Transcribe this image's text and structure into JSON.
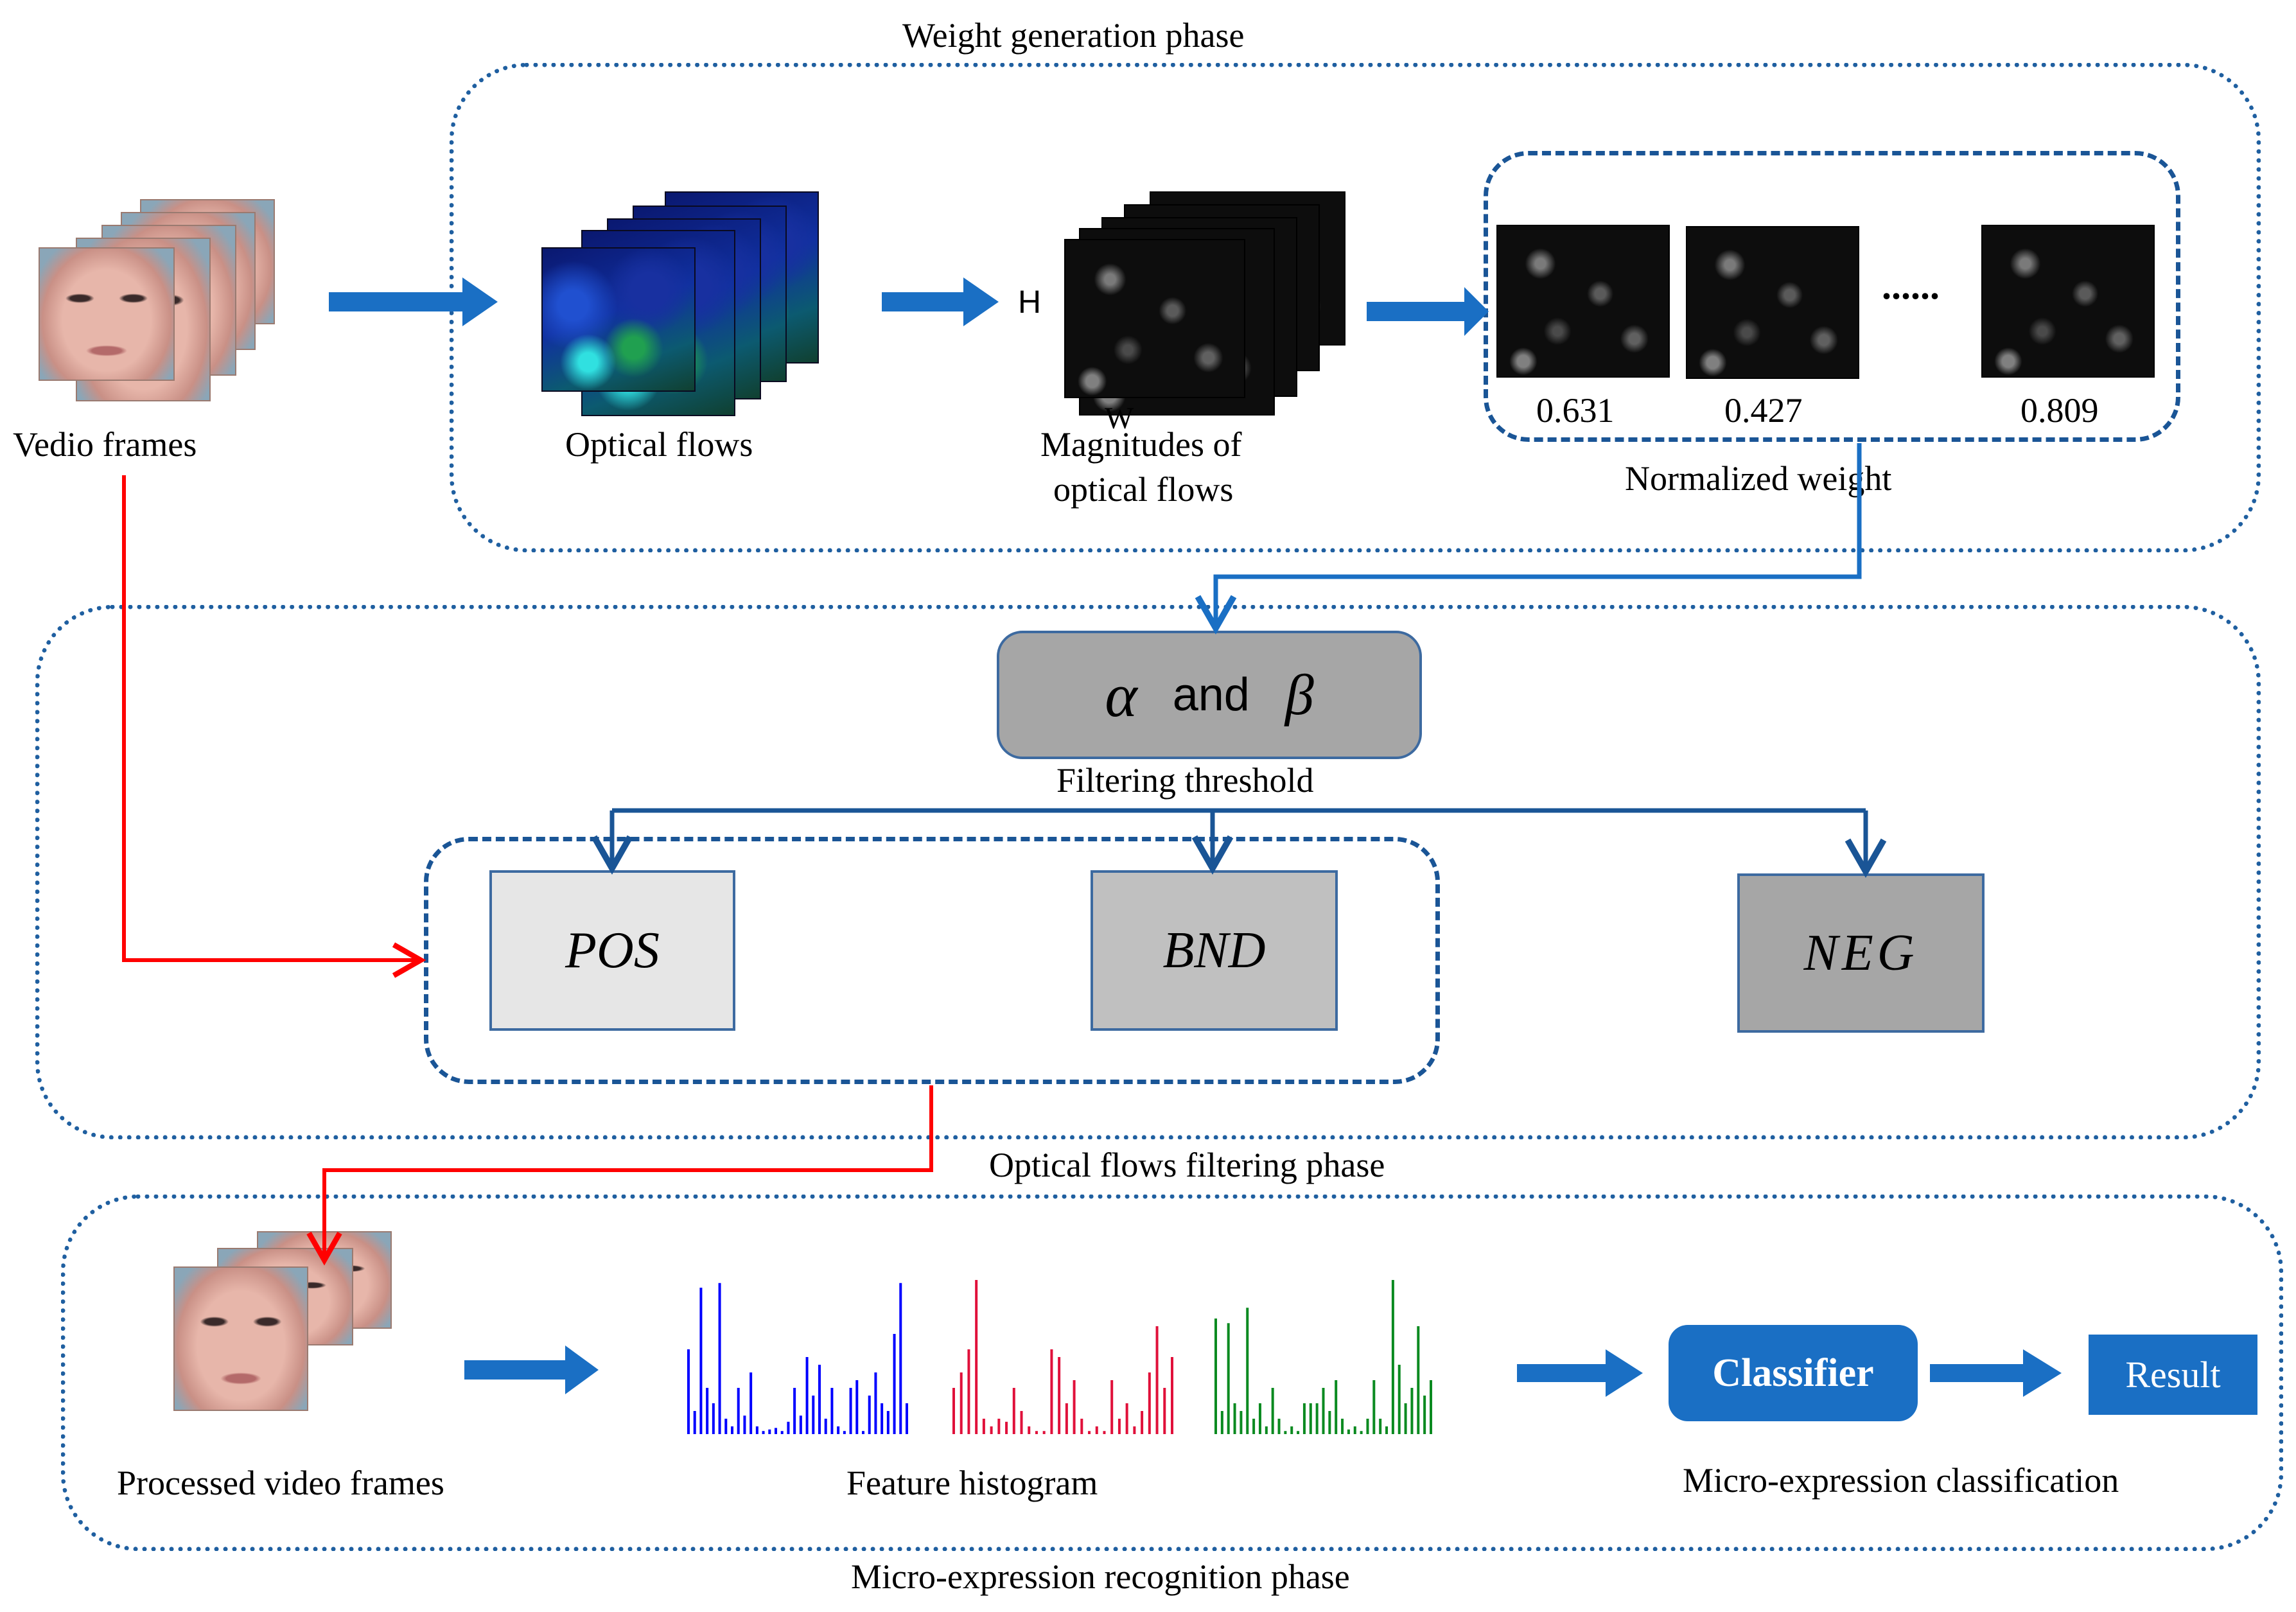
{
  "phases": {
    "weight_generation": "Weight generation phase",
    "filtering": "Optical flows filtering  phase",
    "recognition": "Micro-expression recognition  phase"
  },
  "weight_generation": {
    "video_frames_label": "Vedio frames",
    "optical_flows_label": "Optical flows",
    "magnitudes_label_line1": "Magnitudes of",
    "magnitudes_label_line2": "optical flows",
    "axis_h": "H",
    "axis_w": "W",
    "normalized_weight_label": "Normalized weight",
    "ellipsis": "......",
    "weights": [
      "0.631",
      "0.427",
      "0.809"
    ]
  },
  "filtering": {
    "threshold_alpha": "α",
    "threshold_and": "and",
    "threshold_beta": "β",
    "threshold_label": "Filtering threshold",
    "regions": [
      {
        "label": "POS",
        "color": "#e6e6e6"
      },
      {
        "label": "BND",
        "color": "#c0c0c0"
      },
      {
        "label": "NEG",
        "color": "#a6a6a6"
      }
    ]
  },
  "recognition": {
    "processed_frames_label": "Processed video frames",
    "feature_histogram_label": "Feature histogram",
    "classifier_label": "Classifier",
    "result_label": "Result",
    "classification_label": "Micro-expression classification"
  },
  "colors": {
    "phase_border": "#1f5fa0",
    "arrow_blue": "#1a6fc4",
    "connector_blue": "#1a5596",
    "connector_red": "#ff0000",
    "hist_blue": "#0000ff",
    "hist_red": "#e0103a",
    "hist_green": "#0a8a20"
  },
  "histograms": [
    {
      "name": "blue",
      "color": "#0000ff",
      "values": [
        0.55,
        0.15,
        0.95,
        0.3,
        0.2,
        0.98,
        0.1,
        0.05,
        0.3,
        0.12,
        0.4,
        0.05,
        0.02,
        0.03,
        0.04,
        0.02,
        0.08,
        0.3,
        0.12,
        0.5,
        0.25,
        0.45,
        0.1,
        0.3,
        0.05,
        0.02,
        0.3,
        0.35,
        0.02,
        0.25,
        0.4,
        0.2,
        0.15,
        0.65,
        0.98,
        0.2
      ]
    },
    {
      "name": "red",
      "color": "#e0103a",
      "values": [
        0.3,
        0.4,
        0.55,
        1.0,
        0.1,
        0.05,
        0.1,
        0.08,
        0.3,
        0.15,
        0.05,
        0.02,
        0.02,
        0.55,
        0.5,
        0.2,
        0.35,
        0.1,
        0.02,
        0.05,
        0.02,
        0.35,
        0.1,
        0.2,
        0.05,
        0.15,
        0.4,
        0.7,
        0.3,
        0.5
      ]
    },
    {
      "name": "green",
      "color": "#0a8a20",
      "values": [
        0.75,
        0.15,
        0.72,
        0.2,
        0.15,
        0.82,
        0.1,
        0.2,
        0.05,
        0.3,
        0.1,
        0.02,
        0.05,
        0.02,
        0.2,
        0.2,
        0.2,
        0.3,
        0.15,
        0.35,
        0.1,
        0.03,
        0.05,
        0.02,
        0.1,
        0.35,
        0.1,
        0.05,
        1.0,
        0.45,
        0.2,
        0.3,
        0.7,
        0.25,
        0.35
      ]
    }
  ]
}
